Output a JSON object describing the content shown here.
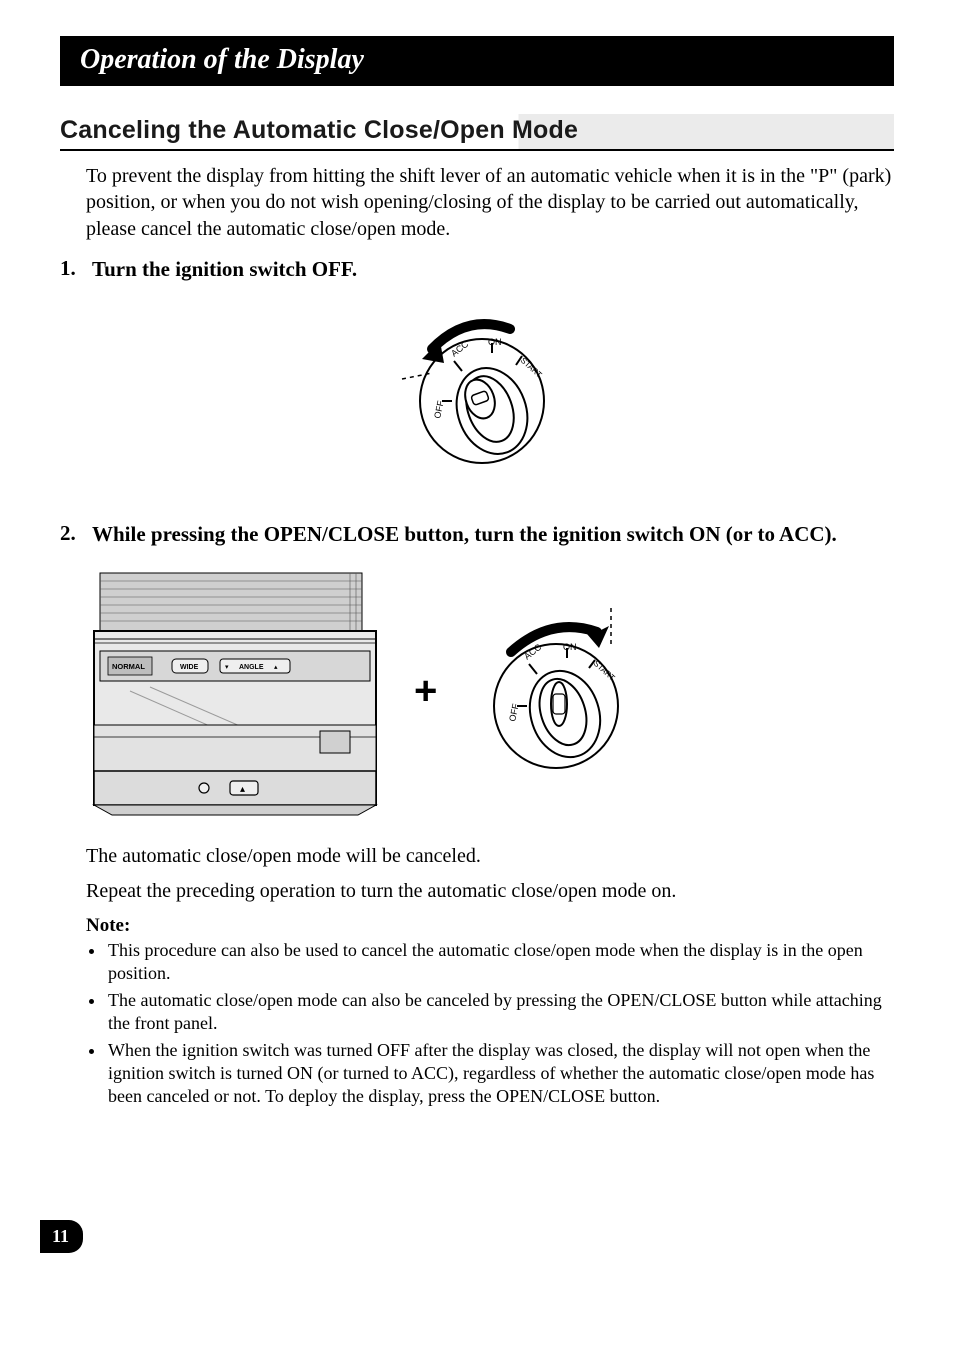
{
  "header": {
    "title": "Operation of the Display"
  },
  "section": {
    "title": "Canceling the Automatic Close/Open Mode"
  },
  "intro": "To prevent the display from hitting the shift lever of an automatic vehicle when it is in the \"P\" (park) position, or when you do not wish opening/closing of the display to be carried out automatically, please cancel the automatic close/open mode.",
  "steps": [
    {
      "num": "1.",
      "text": "Turn the ignition switch OFF."
    },
    {
      "num": "2.",
      "text": "While pressing the OPEN/CLOSE button, turn the ignition switch ON (or to ACC)."
    }
  ],
  "figure1": {
    "labels": {
      "off": "OFF",
      "acc": "ACC",
      "on": "ON",
      "start": "START"
    }
  },
  "figure2": {
    "device_labels": {
      "normal": "NORMAL",
      "wide": "WIDE",
      "angle": "ANGLE"
    },
    "plus": "+",
    "ignition_labels": {
      "off": "OFF",
      "acc": "ACC",
      "on": "ON",
      "start": "START"
    }
  },
  "result1": "The automatic close/open mode will be canceled.",
  "result2": "Repeat the preceding operation to turn the automatic close/open mode on.",
  "note_heading": "Note:",
  "notes": [
    "This procedure can also be used to cancel the automatic close/open mode when the display is in the open position.",
    "The automatic close/open mode can also be canceled by pressing the OPEN/CLOSE button while attaching the front panel.",
    "When the ignition switch was turned OFF after the display was closed, the display will not open when the ignition switch is turned ON (or turned to ACC), regardless of whether the automatic close/open mode has been canceled or not. To deploy the display, press the OPEN/CLOSE button."
  ],
  "page_number": "11"
}
